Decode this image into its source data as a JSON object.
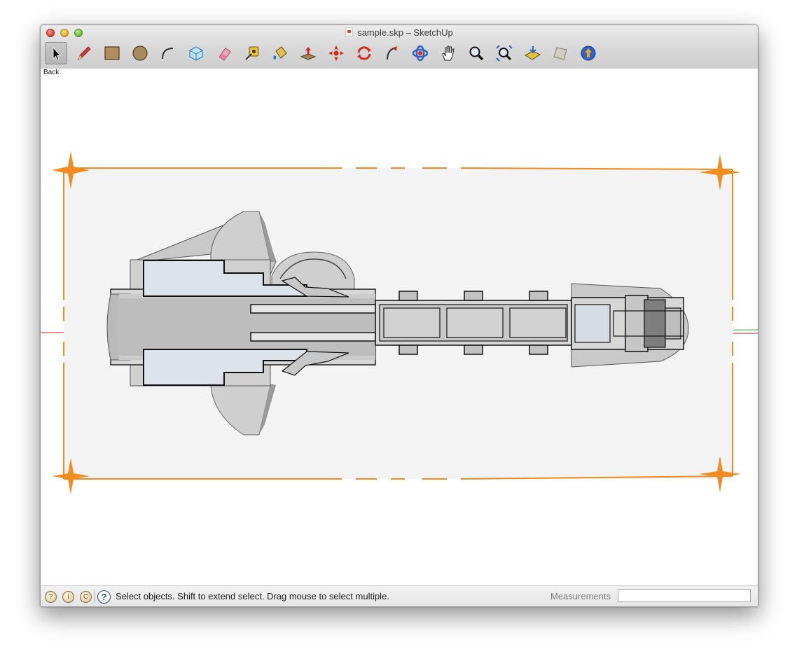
{
  "window": {
    "title": "sample.skp – SketchUp"
  },
  "toolbar": {
    "tools": [
      {
        "name": "Select",
        "icon": "arrow-pointer-icon"
      },
      {
        "name": "Line",
        "icon": "pencil-icon"
      },
      {
        "name": "Rectangle",
        "icon": "rectangle-icon"
      },
      {
        "name": "Circle",
        "icon": "circle-icon"
      },
      {
        "name": "Arc",
        "icon": "arc-icon"
      },
      {
        "name": "Make Component",
        "icon": "component-icon"
      },
      {
        "name": "Eraser",
        "icon": "eraser-icon"
      },
      {
        "name": "Tape Measure",
        "icon": "tape-measure-icon"
      },
      {
        "name": "Paint Bucket",
        "icon": "paint-bucket-icon"
      },
      {
        "name": "Push/Pull",
        "icon": "push-pull-icon"
      },
      {
        "name": "Move",
        "icon": "move-icon"
      },
      {
        "name": "Rotate",
        "icon": "rotate-icon"
      },
      {
        "name": "Follow Me",
        "icon": "follow-me-icon"
      },
      {
        "name": "Orbit",
        "icon": "orbit-icon"
      },
      {
        "name": "Pan",
        "icon": "pan-hand-icon"
      },
      {
        "name": "Zoom",
        "icon": "zoom-icon"
      },
      {
        "name": "Zoom Extents",
        "icon": "zoom-extents-icon"
      },
      {
        "name": "Previous",
        "icon": "previous-view-icon"
      },
      {
        "name": "Section Plane",
        "icon": "section-plane-icon"
      },
      {
        "name": "Share Model",
        "icon": "share-model-icon"
      }
    ]
  },
  "viewport": {
    "scene_tab_label": "Back",
    "section_plane_color": "#f28c1e",
    "red_axis_color": "#cc2222",
    "green_axis_color": "#22aa22"
  },
  "statusbar": {
    "hint": "Select objects. Shift to extend select. Drag mouse to select multiple.",
    "measurements_label": "Measurements",
    "measurements_value": "",
    "icons": [
      "geolocation-icon",
      "credits-icon",
      "copyright-icon",
      "help-icon"
    ]
  }
}
